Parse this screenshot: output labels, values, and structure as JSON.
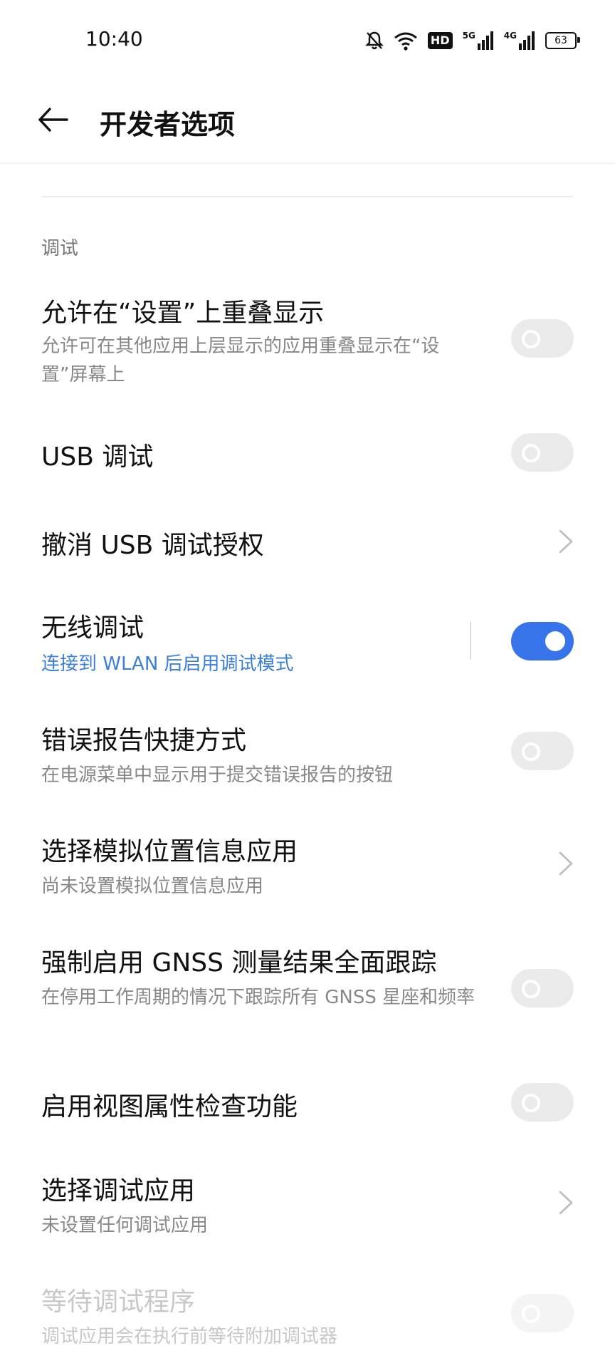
{
  "status_bar": {
    "time": "10:40",
    "hd_label": "HD",
    "net1": "5G",
    "net2": "4G",
    "battery": "63"
  },
  "header": {
    "title": "开发者选项"
  },
  "section_label": "调试",
  "items": [
    {
      "title": "允许在“设置”上重叠显示",
      "subtitle": "允许可在其他应用上层显示的应用重叠显示在“设置”屏幕上",
      "control": "toggle",
      "state": "off"
    },
    {
      "title": "USB 调试",
      "control": "toggle",
      "state": "off"
    },
    {
      "title": "撤消 USB 调试授权",
      "control": "chevron"
    },
    {
      "title": "无线调试",
      "subtitle": "连接到 WLAN 后启用调试模式",
      "control": "toggle",
      "state": "on"
    },
    {
      "title": "错误报告快捷方式",
      "subtitle": "在电源菜单中显示用于提交错误报告的按钮",
      "control": "toggle",
      "state": "off"
    },
    {
      "title": "选择模拟位置信息应用",
      "subtitle": "尚未设置模拟位置信息应用",
      "control": "chevron"
    },
    {
      "title": "强制启用 GNSS 测量结果全面跟踪",
      "subtitle": "在停用工作周期的情况下跟踪所有 GNSS 星座和频率",
      "control": "toggle",
      "state": "off"
    },
    {
      "title": "启用视图属性检查功能",
      "control": "toggle",
      "state": "off"
    },
    {
      "title": "选择调试应用",
      "subtitle": "未设置任何调试应用",
      "control": "chevron"
    },
    {
      "title": "等待调试程序",
      "subtitle": "调试应用会在执行前等待附加调试器",
      "control": "toggle",
      "state": "off",
      "enabled": false
    }
  ],
  "colors": {
    "accent": "#3774e9",
    "link": "#3b7fd9",
    "toggle_off": "#ebebeb"
  },
  "icons": [
    "mute-bell-icon",
    "wifi-icon",
    "signal-icon",
    "battery-icon",
    "back-arrow-icon",
    "chevron-right-icon"
  ]
}
